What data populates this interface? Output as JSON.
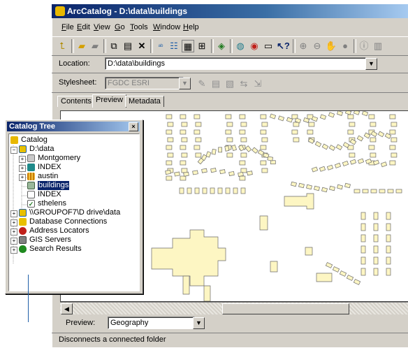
{
  "window": {
    "title": "ArcCatalog - D:\\data\\buildings",
    "icon": "arccatalog-icon"
  },
  "menu": [
    {
      "label": "File",
      "key": "F"
    },
    {
      "label": "Edit",
      "key": "E"
    },
    {
      "label": "View",
      "key": "V"
    },
    {
      "label": "Go",
      "key": "G"
    },
    {
      "label": "Tools",
      "key": "T"
    },
    {
      "label": "Window",
      "key": "W"
    },
    {
      "label": "Help",
      "key": "H"
    }
  ],
  "toolbar_icons": [
    "up-one-level-icon",
    "connect-folder-icon",
    "disconnect-folder-icon",
    "copy-icon",
    "paste-icon",
    "delete-icon",
    "large-icons-icon",
    "list-icon",
    "details-icon",
    "thumbnails-icon",
    "launch-arcmap-icon",
    "metadata-icon",
    "arctoolbox-icon",
    "command-line-icon",
    "whats-this-icon",
    "zoom-in-icon",
    "zoom-out-icon",
    "pan-icon",
    "full-extent-icon",
    "identify-icon"
  ],
  "location": {
    "label": "Location:",
    "value": "D:\\data\\buildings"
  },
  "stylesheet": {
    "label": "Stylesheet:",
    "value": "FGDC ESRI"
  },
  "tabs": [
    "Contents",
    "Preview",
    "Metadata"
  ],
  "active_tab": "Preview",
  "preview": {
    "label": "Preview:",
    "value": "Geography"
  },
  "status": "Disconnects a connected folder",
  "catalog_tree": {
    "title": "Catalog Tree",
    "close": "×",
    "items": [
      {
        "label": "Catalog",
        "icon": "catalog-icon"
      },
      {
        "label": "D:\\data",
        "icon": "folder-connection-icon"
      },
      {
        "label": "Montgomery",
        "icon": "geodatabase-icon"
      },
      {
        "label": "INDEX",
        "icon": "index-icon"
      },
      {
        "label": "austin",
        "icon": "raster-icon"
      },
      {
        "label": "buildings",
        "icon": "shapefile-icon",
        "selected": true
      },
      {
        "label": "INDEX",
        "icon": "index-file-icon"
      },
      {
        "label": "sthelens",
        "icon": "sthelens-icon"
      },
      {
        "label": "\\\\GROUPOF7\\D drive\\data",
        "icon": "network-folder-icon"
      },
      {
        "label": "Database Connections",
        "icon": "database-connections-icon"
      },
      {
        "label": "Address Locators",
        "icon": "address-locators-icon"
      },
      {
        "label": "GIS Servers",
        "icon": "gis-servers-icon"
      },
      {
        "label": "Search Results",
        "icon": "search-results-icon"
      }
    ]
  },
  "colors": {
    "building_fill": "#fdf6c3",
    "selection": "#0a246a",
    "window_face": "#d4d0c8"
  }
}
